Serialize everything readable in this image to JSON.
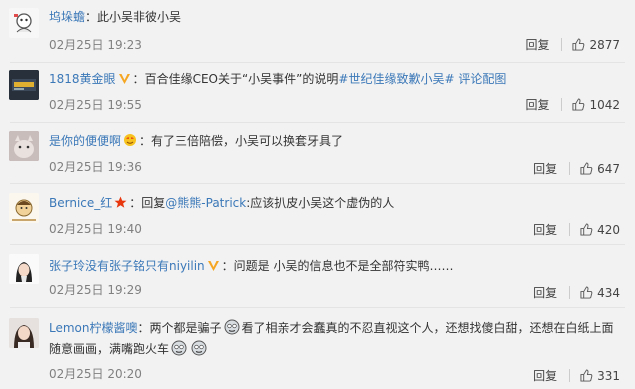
{
  "comments": [
    {
      "user": "坞垛蟾",
      "sep": "：",
      "text": "此小吴非彼小吴",
      "time": "02月25日 19:23",
      "reply": "回复",
      "likes": "2877"
    },
    {
      "user": "1818黄金眼",
      "sep": "：",
      "text_a": "百合佳缘CEO关于“小吴事件”的说明",
      "link_a": "#世纪佳缘致歉小吴#",
      "link_b": "评论配图",
      "time": "02月25日 19:55",
      "reply": "回复",
      "likes": "1042"
    },
    {
      "user": "是你的便便啊",
      "sep": "：",
      "text": "有了三倍陪偿，小吴可以换套牙具了",
      "time": "02月25日 19:36",
      "reply": "回复",
      "likes": "647"
    },
    {
      "user": "Bernice_红",
      "sep": "：",
      "text_a": "回复",
      "link_a": "@熊熊-Patrick",
      "text_b": ":应该扒皮小吴这个虚伪的人",
      "time": "02月25日 19:40",
      "reply": "回复",
      "likes": "420"
    },
    {
      "user": "张子玲没有张子铭只有niyilin",
      "sep": "：",
      "text": "问题是 小吴的信息也不是全部符实鸭……",
      "time": "02月25日 19:29",
      "reply": "回复",
      "likes": "434"
    },
    {
      "user": "Lemon柠檬酱噢",
      "sep": "：",
      "text_a": "两个都是骗子",
      "text_b": "看了相亲才会蠢真的不忍直视这个人，还想找傻白甜，还想在白纸上面",
      "text_c": "随意画画，满嘴跑火车",
      "time": "02月25日 20:20",
      "reply": "回复",
      "likes": "331"
    }
  ],
  "icons": {
    "like": "thumbs-up-icon",
    "verified": "verified-v-icon",
    "star": "star-badge-icon",
    "emoji": "emoji-icon"
  },
  "colors": {
    "link": "#3b78b8",
    "verified": "#f5a623",
    "star": "#e8360e",
    "muted": "#808080"
  }
}
